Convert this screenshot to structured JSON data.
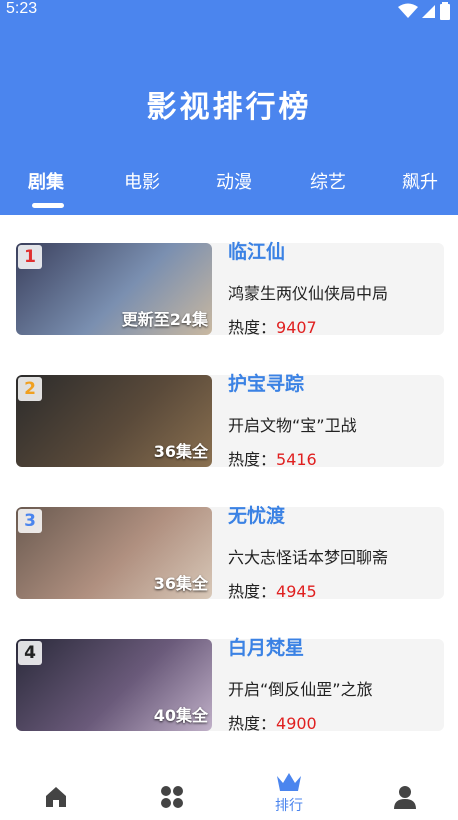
{
  "status_bar": {
    "time": "5:23"
  },
  "header": {
    "title": "影视排行榜"
  },
  "tabs": [
    {
      "label": "剧集",
      "active": true
    },
    {
      "label": "电影",
      "active": false
    },
    {
      "label": "动漫",
      "active": false
    },
    {
      "label": "综艺",
      "active": false
    },
    {
      "label": "飙升",
      "active": false
    }
  ],
  "heat_label": "热度：",
  "items": [
    {
      "rank": "1",
      "rank_color": "#e03030",
      "title": "临江仙",
      "desc": "鸿蒙生两仪仙侠局中局",
      "episodes": "更新至24集",
      "heat": "9407",
      "thumb_colors": [
        "#3a3f5c",
        "#7a8fb0",
        "#c9b8a0"
      ]
    },
    {
      "rank": "2",
      "rank_color": "#f0a020",
      "title": "护宝寻踪",
      "desc": "开启文物“宝”卫战",
      "episodes": "36集全",
      "heat": "5416",
      "thumb_colors": [
        "#2b2b2b",
        "#5a4a3a",
        "#8a7050"
      ]
    },
    {
      "rank": "3",
      "rank_color": "#4b85ee",
      "title": "无忧渡",
      "desc": "六大志怪话本梦回聊斋",
      "episodes": "36集全",
      "heat": "4945",
      "thumb_colors": [
        "#6a5a50",
        "#b09080",
        "#d8c8b8"
      ]
    },
    {
      "rank": "4",
      "rank_color": "#222222",
      "title": "白月梵星",
      "desc": "开启“倒反仙罡”之旅",
      "episodes": "40集全",
      "heat": "4900",
      "thumb_colors": [
        "#2a2a3a",
        "#6a5a7a",
        "#c0b0c8"
      ]
    }
  ],
  "bottom_nav": [
    {
      "icon": "home-icon",
      "label": "",
      "active": false
    },
    {
      "icon": "grid-icon",
      "label": "",
      "active": false
    },
    {
      "icon": "crown-icon",
      "label": "排行",
      "active": true
    },
    {
      "icon": "user-icon",
      "label": "",
      "active": false
    }
  ],
  "colors": {
    "primary": "#4b85ee",
    "heat": "#e02020",
    "inactive_icon": "#444444"
  }
}
